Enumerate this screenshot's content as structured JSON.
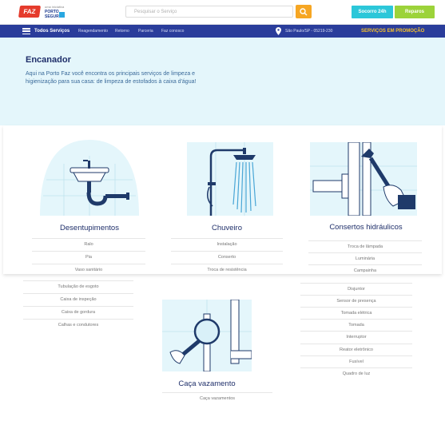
{
  "header": {
    "logo_text": "FAZ",
    "partner_logo": {
      "line1": "uma iniciativa",
      "line2": "PORTO",
      "line3": "SEGURO"
    },
    "search": {
      "placeholder": "Pesquisar o Serviço"
    },
    "buttons": {
      "quick": "Socorro 24h",
      "repair": "Reparos"
    }
  },
  "nav": {
    "all_services": "Todos Serviços",
    "links": [
      "Reagendamento",
      "Retorno",
      "Parceria",
      "Faz conosco"
    ],
    "location": "São Paulo/SP - 05219-230",
    "promo": "SERVIÇOS EM PROMOÇÃO"
  },
  "hero": {
    "title": "Encanador",
    "description": "Aqui na Porto Faz você encontra os principais serviços de limpeza e higienização para sua casa: de limpeza de estofados à caixa d'água!"
  },
  "categories": {
    "desentupimentos": {
      "title": "Desentupimentos",
      "items": [
        "Ralo",
        "Pia",
        "Vaso sanitário",
        "Tubulação de esgoto",
        "Caixa de inspeção",
        "Caixa de gordura",
        "Calhas e condutores"
      ]
    },
    "chuveiro": {
      "title": "Chuveiro",
      "items": [
        "Instalação",
        "Conserto",
        "Troca de resistência"
      ]
    },
    "consertos": {
      "title": "Consertos hidráulicos",
      "items": [
        "Troca de lâmpada",
        "Luminária",
        "Campainha",
        "Disjuntor",
        "Sensor de presença",
        "Tomada elétrica",
        "Tomada",
        "Interruptor",
        "Reator eletrônico",
        "Fusível",
        "Quadro de luz"
      ]
    },
    "vazamento": {
      "title": "Caça vazamento",
      "items": [
        "Caça vazamentos"
      ]
    }
  },
  "colors": {
    "navbar": "#2a3d9b",
    "hero_bg": "#e4f6fb",
    "promo": "#f6c12a",
    "search_button": "#f6a623",
    "quick_button": "#2cc7d9",
    "repair_button": "#9cd33a"
  },
  "icons": [
    "search-icon",
    "menu-icon",
    "location-pin-icon"
  ]
}
